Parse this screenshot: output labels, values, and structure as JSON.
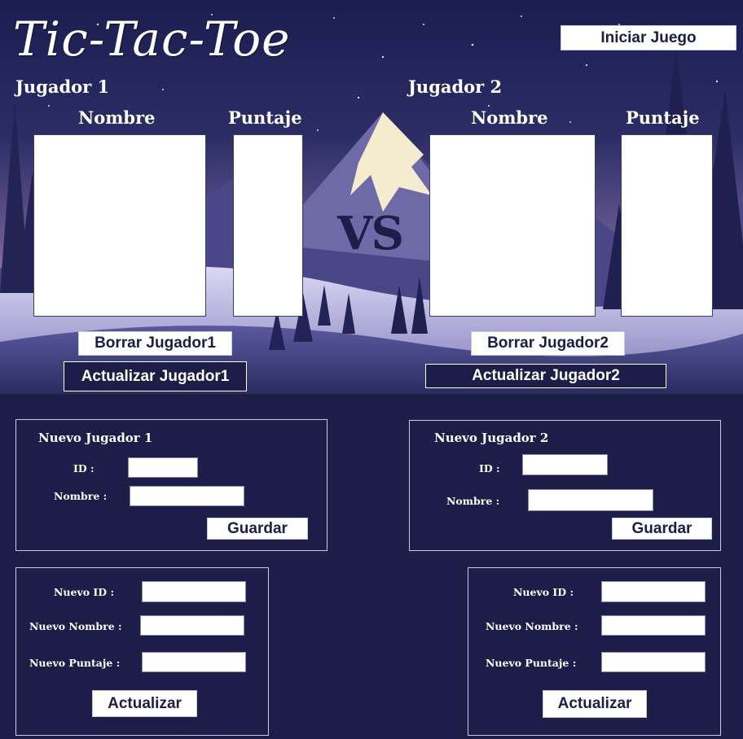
{
  "app": {
    "title": "Tic-Tac-Toe"
  },
  "toolbar": {
    "start_label": "Iniciar Juego"
  },
  "player1": {
    "heading": "Jugador 1",
    "name_col": "Nombre",
    "score_col": "Puntaje",
    "delete_label": "Borrar Jugador1",
    "update_label": "Actualizar Jugador1"
  },
  "player2": {
    "heading": "Jugador 2",
    "name_col": "Nombre",
    "score_col": "Puntaje",
    "delete_label": "Borrar Jugador2",
    "update_label": "Actualizar Jugador2"
  },
  "versus": "VS",
  "new_player1": {
    "title": "Nuevo Jugador 1",
    "id_label": "ID :",
    "name_label": "Nombre :",
    "save_label": "Guardar",
    "id_value": "",
    "name_value": ""
  },
  "new_player2": {
    "title": "Nuevo Jugador 2",
    "id_label": "ID :",
    "name_label": "Nombre :",
    "save_label": "Guardar",
    "id_value": "",
    "name_value": ""
  },
  "update1": {
    "new_id_label": "Nuevo ID :",
    "new_name_label": "Nuevo Nombre :",
    "new_score_label": "Nuevo Puntaje :",
    "update_label": "Actualizar"
  },
  "update2": {
    "new_id_label": "Nuevo ID :",
    "new_name_label": "Nuevo Nombre :",
    "new_score_label": "Nuevo Puntaje :",
    "update_label": "Actualizar"
  },
  "colors": {
    "background": "#1c1d48",
    "accent_text": "#1c1d48",
    "sky_top": "#1d1f52",
    "sky_bottom": "#c98aa8",
    "white": "#ffffff"
  }
}
